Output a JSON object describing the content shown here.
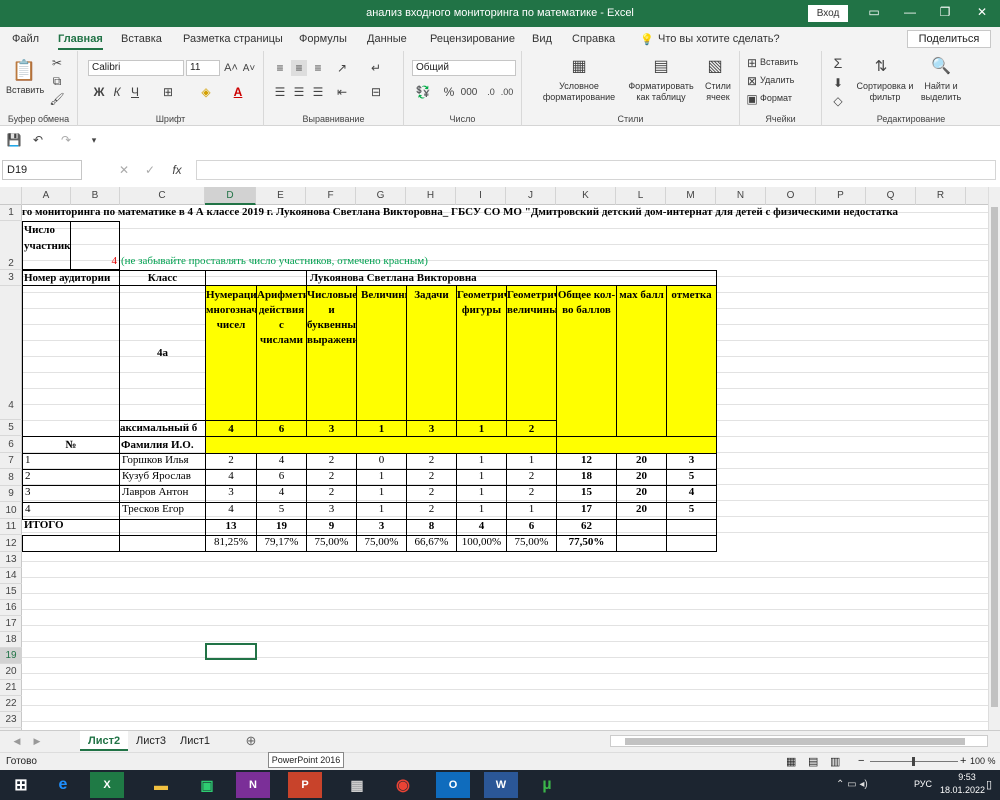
{
  "titlebar": {
    "title": "анализ входного мониторинга по математике  -  Excel",
    "login": "Вход"
  },
  "menu": {
    "items": [
      "Файл",
      "Главная",
      "Вставка",
      "Разметка страницы",
      "Формулы",
      "Данные",
      "Рецензирование",
      "Вид",
      "Справка"
    ],
    "search": "Что вы хотите сделать?",
    "share": "Поделиться"
  },
  "ribbon": {
    "paste": "Вставить",
    "clipboard": "Буфер обмена",
    "font_name": "Calibri",
    "font_size": "11",
    "font_group": "Шрифт",
    "align_group": "Выравнивание",
    "number_format": "Общий",
    "number_group": "Число",
    "cond_format": "Условное форматирование",
    "format_table": "Форматировать как таблицу",
    "cell_styles": "Стили ячеек",
    "styles_group": "Стили",
    "insert": "Вставить",
    "delete": "Удалить",
    "format": "Формат",
    "cells_group": "Ячейки",
    "sort": "Сортировка и фильтр",
    "find": "Найти и выделить",
    "edit_group": "Редактирование"
  },
  "formula": {
    "namebox": "D19",
    "fx": "fx"
  },
  "columns": [
    "A",
    "B",
    "C",
    "D",
    "E",
    "F",
    "G",
    "H",
    "I",
    "J",
    "K",
    "L",
    "M",
    "N",
    "O",
    "P",
    "Q",
    "R"
  ],
  "rows": [
    "1",
    "2",
    "3",
    "4",
    "5",
    "6",
    "7",
    "8",
    "9",
    "10",
    "11",
    "12",
    "13",
    "14",
    "15",
    "16",
    "17",
    "18",
    "19",
    "20",
    "21",
    "22",
    "23"
  ],
  "sheet": {
    "r1": "го мониторинга по математике в 4 А классе 2019 г. Лукоянова Светлана Викторовна_ ГБСУ СО МО \"Дмитровский детский дом-интернат для детей с физическими недостатка",
    "r2a": "Число участников",
    "r2b": "4",
    "r2note": "(не забывайте проставлять число участников, отмечено красным)",
    "r3a": "Номер аудитории",
    "r3c": "Класс",
    "r3f": "Лукоянова Светлана Викторовна",
    "class": "4а",
    "headers": [
      "Нумерация многозначных чисел",
      "Арифметические действия с числами",
      "Числовые и буквенные выражения",
      "Величины",
      "Задачи",
      "Геометрические фигуры",
      "Геометрические величины",
      "Общее кол-во баллов",
      "мах балл",
      "отметка"
    ],
    "r5c": "аксимальный б",
    "max": [
      "4",
      "6",
      "3",
      "1",
      "3",
      "1",
      "2"
    ],
    "r6a": "№",
    "r6c": "Фамилия И.О.",
    "students": [
      {
        "n": "1",
        "name": "Горшков Илья",
        "v": [
          "2",
          "4",
          "2",
          "0",
          "2",
          "1",
          "1"
        ],
        "tot": "12",
        "max": "20",
        "mark": "3"
      },
      {
        "n": "2",
        "name": "Кузуб Ярослав",
        "v": [
          "4",
          "6",
          "2",
          "1",
          "2",
          "1",
          "2"
        ],
        "tot": "18",
        "max": "20",
        "mark": "5"
      },
      {
        "n": "3",
        "name": "Лавров Антон",
        "v": [
          "3",
          "4",
          "2",
          "1",
          "2",
          "1",
          "2"
        ],
        "tot": "15",
        "max": "20",
        "mark": "4"
      },
      {
        "n": "4",
        "name": "Тресков Егор",
        "v": [
          "4",
          "5",
          "3",
          "1",
          "2",
          "1",
          "1"
        ],
        "tot": "17",
        "max": "20",
        "mark": "5"
      }
    ],
    "total_label": "ИТОГО",
    "totals": [
      "13",
      "19",
      "9",
      "3",
      "8",
      "4",
      "6",
      "62"
    ],
    "pct": [
      "81,25%",
      "79,17%",
      "75,00%",
      "75,00%",
      "66,67%",
      "100,00%",
      "75,00%",
      "77,50%"
    ]
  },
  "tabs": [
    "Лист2",
    "Лист3",
    "Лист1"
  ],
  "status": {
    "ready": "Готово",
    "zoom": "100 %",
    "tooltip": "PowerPoint 2016"
  },
  "taskbar": {
    "time": "9:53",
    "date": "18.01.2022",
    "lang": "РУС"
  }
}
